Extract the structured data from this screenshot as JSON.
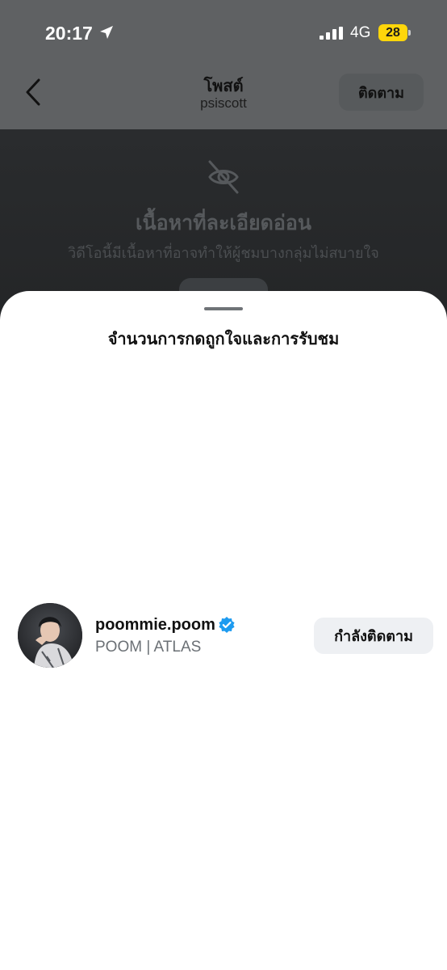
{
  "status_bar": {
    "time": "20:17",
    "network": "4G",
    "battery": "28",
    "icons": [
      "location-arrow-icon",
      "signal-bars-icon"
    ]
  },
  "header": {
    "title": "โพสต์",
    "subtitle": "psiscott",
    "follow_label": "ติดตาม"
  },
  "content": {
    "sensitive_title": "เนื้อหาที่ละเอียดอ่อน",
    "sensitive_desc": "วิดีโอนี้มีเนื้อหาที่อาจทำให้ผู้ชมบางกลุ่มไม่สบายใจ"
  },
  "sheet": {
    "title": "จำนวนการกดถูกใจและการรับชม",
    "users": [
      {
        "username": "poommie.poom",
        "verified": true,
        "full_name": "POOM | ATLAS",
        "button_label": "กำลังติดตาม"
      }
    ]
  },
  "colors": {
    "verified_blue": "#1d9bf0",
    "battery_yellow": "#ffd60a"
  }
}
